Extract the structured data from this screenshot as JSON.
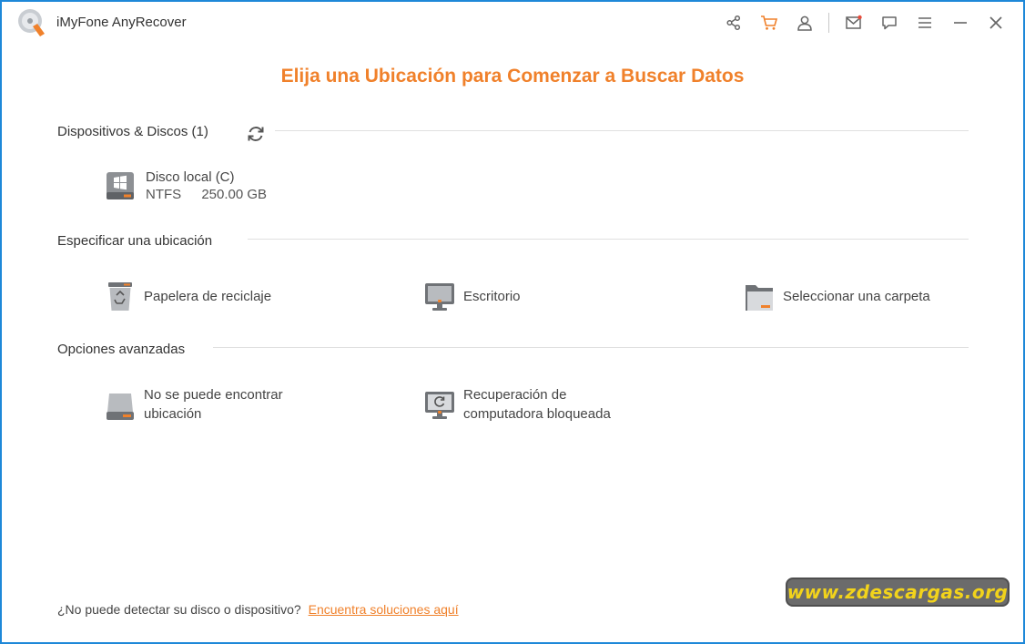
{
  "app": {
    "title": "iMyFone AnyRecover"
  },
  "titlebar_icons": [
    "share-icon",
    "cart-icon",
    "user-icon",
    "mail-icon",
    "feedback-icon",
    "menu-icon",
    "minimize-icon",
    "close-icon"
  ],
  "heading": "Elija una Ubicación para Comenzar a Buscar Datos",
  "devices": {
    "title": "Dispositivos & Discos (1)",
    "disks": [
      {
        "name": "Disco local (C)",
        "fs": "NTFS",
        "size": "250.00 GB"
      }
    ]
  },
  "locations": {
    "title": "Especificar una ubicación",
    "items": [
      {
        "label": "Papelera de reciclaje",
        "icon": "recycle-bin-icon"
      },
      {
        "label": "Escritorio",
        "icon": "desktop-icon"
      },
      {
        "label": "Seleccionar una carpeta",
        "icon": "folder-icon"
      }
    ]
  },
  "advanced": {
    "title": "Opciones avanzadas",
    "items": [
      {
        "line1": "No se puede encontrar",
        "line2": "ubicación",
        "icon": "drive-icon"
      },
      {
        "line1": "Recuperación de",
        "line2": "computadora bloqueada",
        "icon": "crashed-computer-icon"
      }
    ]
  },
  "footer": {
    "text": "¿No puede detectar su disco o dispositivo?",
    "link": "Encuentra soluciones aquí"
  },
  "watermark": "www.zdescargas.org",
  "colors": {
    "accent": "#f0812b",
    "window_border": "#1e88d8"
  }
}
